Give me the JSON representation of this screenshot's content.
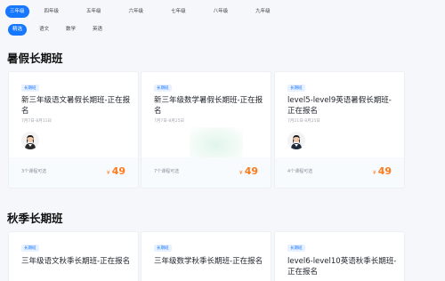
{
  "grades": [
    "三年级",
    "四年级",
    "五年级",
    "六年级",
    "七年级",
    "八年级",
    "九年级"
  ],
  "subjects": [
    "精选",
    "语文",
    "数学",
    "英语"
  ],
  "sections": {
    "summer": "暑假长期班",
    "autumn": "秋季长期班"
  },
  "colors": {
    "accent": "#1677ff",
    "price": "#ff7a1a"
  },
  "summer_cards": [
    {
      "badge": "长期班",
      "title": "新三年级语文暑假长期班-正在报名",
      "date": "7月7日-8月11日",
      "count": "3个课程可选",
      "currency": "¥",
      "price": "49",
      "teacher": "avatar"
    },
    {
      "badge": "长期班",
      "title": "新三年级数学暑假长期班-正在报名",
      "date": "7月7日-8月25日",
      "count": "7个课程可选",
      "currency": "¥",
      "price": "49"
    },
    {
      "badge": "长期班",
      "title": "level5-level9英语暑假长期班-正在报名",
      "date": "7月21日-8月25日",
      "count": "4个课程可选",
      "currency": "¥",
      "price": "49",
      "teacher": "avatar"
    }
  ],
  "autumn_cards": [
    {
      "badge": "长期班",
      "title": "三年级语文秋季长期班-正在报名"
    },
    {
      "badge": "长期班",
      "title": "三年级数学秋季长期班-正在报名"
    },
    {
      "badge": "长期班",
      "title": "level6-level10英语秋季长期班-正在报名"
    }
  ]
}
